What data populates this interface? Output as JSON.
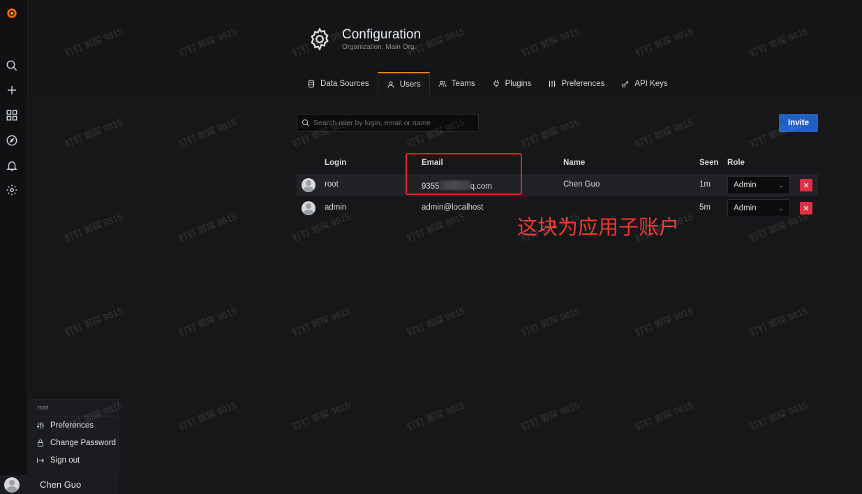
{
  "sidebar": {
    "icons": [
      "grafana-logo-icon",
      "search-icon",
      "plus-icon",
      "dashboards-icon",
      "explore-icon",
      "alerting-icon",
      "configuration-icon"
    ]
  },
  "header": {
    "title": "Configuration",
    "subtitle": "Organization: Main Org."
  },
  "tabs": [
    {
      "label": "Data Sources",
      "icon": "database-icon",
      "active": false
    },
    {
      "label": "Users",
      "icon": "user-icon",
      "active": true
    },
    {
      "label": "Teams",
      "icon": "users-icon",
      "active": false
    },
    {
      "label": "Plugins",
      "icon": "plug-icon",
      "active": false
    },
    {
      "label": "Preferences",
      "icon": "sliders-icon",
      "active": false
    },
    {
      "label": "API Keys",
      "icon": "key-icon",
      "active": false
    }
  ],
  "toolbar": {
    "search_placeholder": "Search user by login, email or name",
    "invite_label": "Invite"
  },
  "table": {
    "columns": [
      "Login",
      "Email",
      "Name",
      "Seen",
      "Role"
    ],
    "rows": [
      {
        "login": "root",
        "email_start": "9355",
        "email_end": "q.com",
        "name": "Chen Guo",
        "seen": "1m",
        "role": "Admin"
      },
      {
        "login": "admin",
        "email": "admin@localhost",
        "name": "",
        "seen": "5m",
        "role": "Admin"
      }
    ]
  },
  "annotation": {
    "text": "这块为应用子账户",
    "color": "#f03a2e"
  },
  "profile_menu": {
    "header": "root",
    "items": [
      "Preferences",
      "Change Password",
      "Sign out"
    ],
    "user_name": "Chen Guo"
  },
  "watermark": {
    "text": "钉钉  郭琛 9815"
  },
  "colors": {
    "accent_orange": "#eb7b18",
    "primary_blue": "#1f60c4",
    "danger_red": "#e02f44",
    "background": "#161719"
  }
}
